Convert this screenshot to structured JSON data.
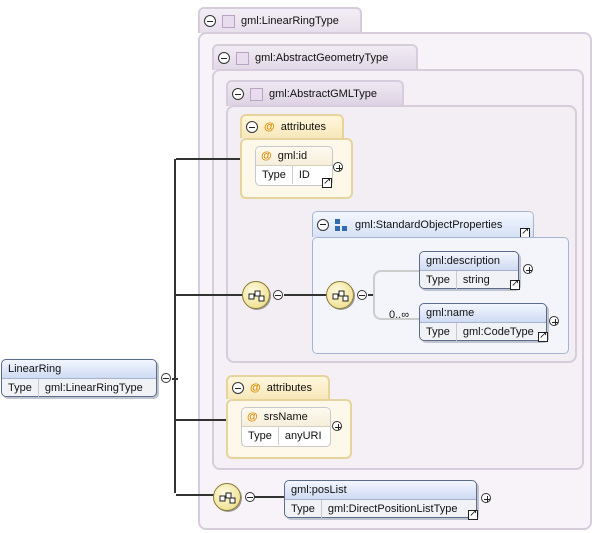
{
  "types": {
    "linear_ring": "gml:LinearRingType",
    "abstract_geometry": "gml:AbstractGeometryType",
    "abstract_gml": "gml:AbstractGMLType"
  },
  "attribute_groups": [
    {
      "label": "attributes",
      "attr_name": "gml:id",
      "type_label": "Type",
      "type_value": "ID"
    },
    {
      "label": "attributes",
      "attr_name": "srsName",
      "type_label": "Type",
      "type_value": "anyURI"
    }
  ],
  "group": {
    "name": "gml:StandardObjectProperties",
    "occurrence": "0..∞",
    "elements": [
      {
        "name": "gml:description",
        "type_label": "Type",
        "type_value": "string"
      },
      {
        "name": "gml:name",
        "type_label": "Type",
        "type_value": "gml:CodeType"
      }
    ]
  },
  "root": {
    "name": "LinearRing",
    "type_label": "Type",
    "type_value": "gml:LinearRingType"
  },
  "pos_list": {
    "name": "gml:posList",
    "type_label": "Type",
    "type_value": "gml:DirectPositionListType"
  },
  "colors": {
    "connector": "#333333",
    "type_border": "#d7ccdc",
    "attr_border": "#e6d49c",
    "element_header": "#cfdaf2"
  },
  "icons": [
    "collapse-icon",
    "expand-icon",
    "complex-type-icon",
    "attribute-icon",
    "sequence-icon",
    "group-icon",
    "reference-link-icon"
  ]
}
